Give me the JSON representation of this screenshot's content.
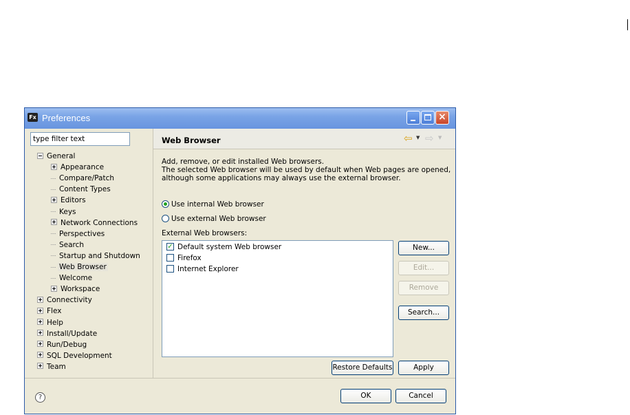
{
  "window": {
    "title": "Preferences",
    "logo": "Fx"
  },
  "filter": {
    "placeholder": "type filter text"
  },
  "tree": {
    "items": [
      {
        "label": "General",
        "level": 0,
        "expander": "minus"
      },
      {
        "label": "Appearance",
        "level": 1,
        "expander": "plus"
      },
      {
        "label": "Compare/Patch",
        "level": 1,
        "expander": "none"
      },
      {
        "label": "Content Types",
        "level": 1,
        "expander": "none"
      },
      {
        "label": "Editors",
        "level": 1,
        "expander": "plus"
      },
      {
        "label": "Keys",
        "level": 1,
        "expander": "none"
      },
      {
        "label": "Network Connections",
        "level": 1,
        "expander": "plus"
      },
      {
        "label": "Perspectives",
        "level": 1,
        "expander": "none"
      },
      {
        "label": "Search",
        "level": 1,
        "expander": "none"
      },
      {
        "label": "Startup and Shutdown",
        "level": 1,
        "expander": "none"
      },
      {
        "label": "Web Browser",
        "level": 1,
        "expander": "none",
        "selected": true
      },
      {
        "label": "Welcome",
        "level": 1,
        "expander": "none"
      },
      {
        "label": "Workspace",
        "level": 1,
        "expander": "plus"
      },
      {
        "label": "Connectivity",
        "level": 0,
        "expander": "plus"
      },
      {
        "label": "Flex",
        "level": 0,
        "expander": "plus"
      },
      {
        "label": "Help",
        "level": 0,
        "expander": "plus"
      },
      {
        "label": "Install/Update",
        "level": 0,
        "expander": "plus"
      },
      {
        "label": "Run/Debug",
        "level": 0,
        "expander": "plus"
      },
      {
        "label": "SQL Development",
        "level": 0,
        "expander": "plus"
      },
      {
        "label": "Team",
        "level": 0,
        "expander": "plus"
      }
    ]
  },
  "page": {
    "title": "Web Browser",
    "description": [
      "Add, remove, or edit installed Web browsers.",
      "The selected Web browser will be used by default when Web pages are opened,",
      "although some applications may always use the external browser."
    ],
    "radio_internal": "Use internal Web browser",
    "radio_external": "Use external Web browser",
    "selected_radio": "internal",
    "external_label": "External Web browsers:",
    "browsers": [
      {
        "label": "Default system Web browser",
        "checked": true
      },
      {
        "label": "Firefox",
        "checked": false
      },
      {
        "label": "Internet Explorer",
        "checked": false
      }
    ],
    "buttons": {
      "new": "New...",
      "edit": "Edit...",
      "remove": "Remove",
      "search": "Search...",
      "restore": "Restore Defaults",
      "apply": "Apply"
    }
  },
  "footer": {
    "ok": "OK",
    "cancel": "Cancel",
    "help_glyph": "?"
  },
  "icons": {
    "back": "back-arrow-icon",
    "forward": "forward-arrow-icon",
    "help": "help-icon",
    "check": "check-icon"
  }
}
